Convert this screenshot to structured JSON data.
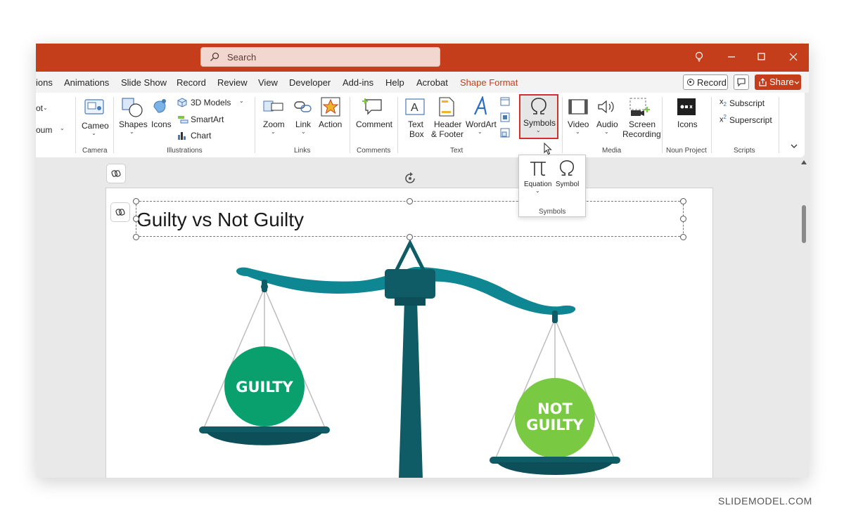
{
  "search": {
    "placeholder": "Search"
  },
  "menu": {
    "items": [
      "ions",
      "Animations",
      "Slide Show",
      "Record",
      "Review",
      "View",
      "Developer",
      "Add-ins",
      "Help",
      "Acrobat"
    ],
    "active": "Shape Format",
    "record_label": "Record",
    "share_label": "Share"
  },
  "ribbon": {
    "partial": {
      "item1": "ot",
      "item2": "oum"
    },
    "camera": {
      "button": "Cameo",
      "group": "Camera"
    },
    "illustrations": {
      "shapes": "Shapes",
      "icons": "Icons",
      "models3d": "3D Models",
      "smartart": "SmartArt",
      "chart": "Chart",
      "group": "Illustrations"
    },
    "links": {
      "zoom": "Zoom",
      "link": "Link",
      "action": "Action",
      "group": "Links"
    },
    "comments": {
      "comment": "Comment",
      "group": "Comments"
    },
    "text": {
      "textbox_1": "Text",
      "textbox_2": "Box",
      "header_1": "Header",
      "header_2": "& Footer",
      "wordart": "WordArt",
      "group": "Text"
    },
    "symbols": {
      "button": "Symbols"
    },
    "media": {
      "video": "Video",
      "audio": "Audio",
      "screen_1": "Screen",
      "screen_2": "Recording",
      "group": "Media"
    },
    "noun": {
      "icons": "Icons",
      "group": "Noun Project"
    },
    "scripts": {
      "subscript": "Subscript",
      "superscript": "Superscript",
      "group": "Scripts"
    }
  },
  "symbols_popup": {
    "equation": "Equation",
    "symbol": "Symbol",
    "group": "Symbols"
  },
  "slide": {
    "title": "Guilty vs Not Guilty",
    "left_pan": "GUILTY",
    "right_pan_1": "NOT",
    "right_pan_2": "GUILTY"
  },
  "colors": {
    "brand": "#c43e1c",
    "teal": "#0e8793",
    "dark_teal": "#0f5b66",
    "guilty": "#0aa06e",
    "not_guilty": "#7ac943"
  },
  "watermark": "SLIDEMODEL.COM"
}
